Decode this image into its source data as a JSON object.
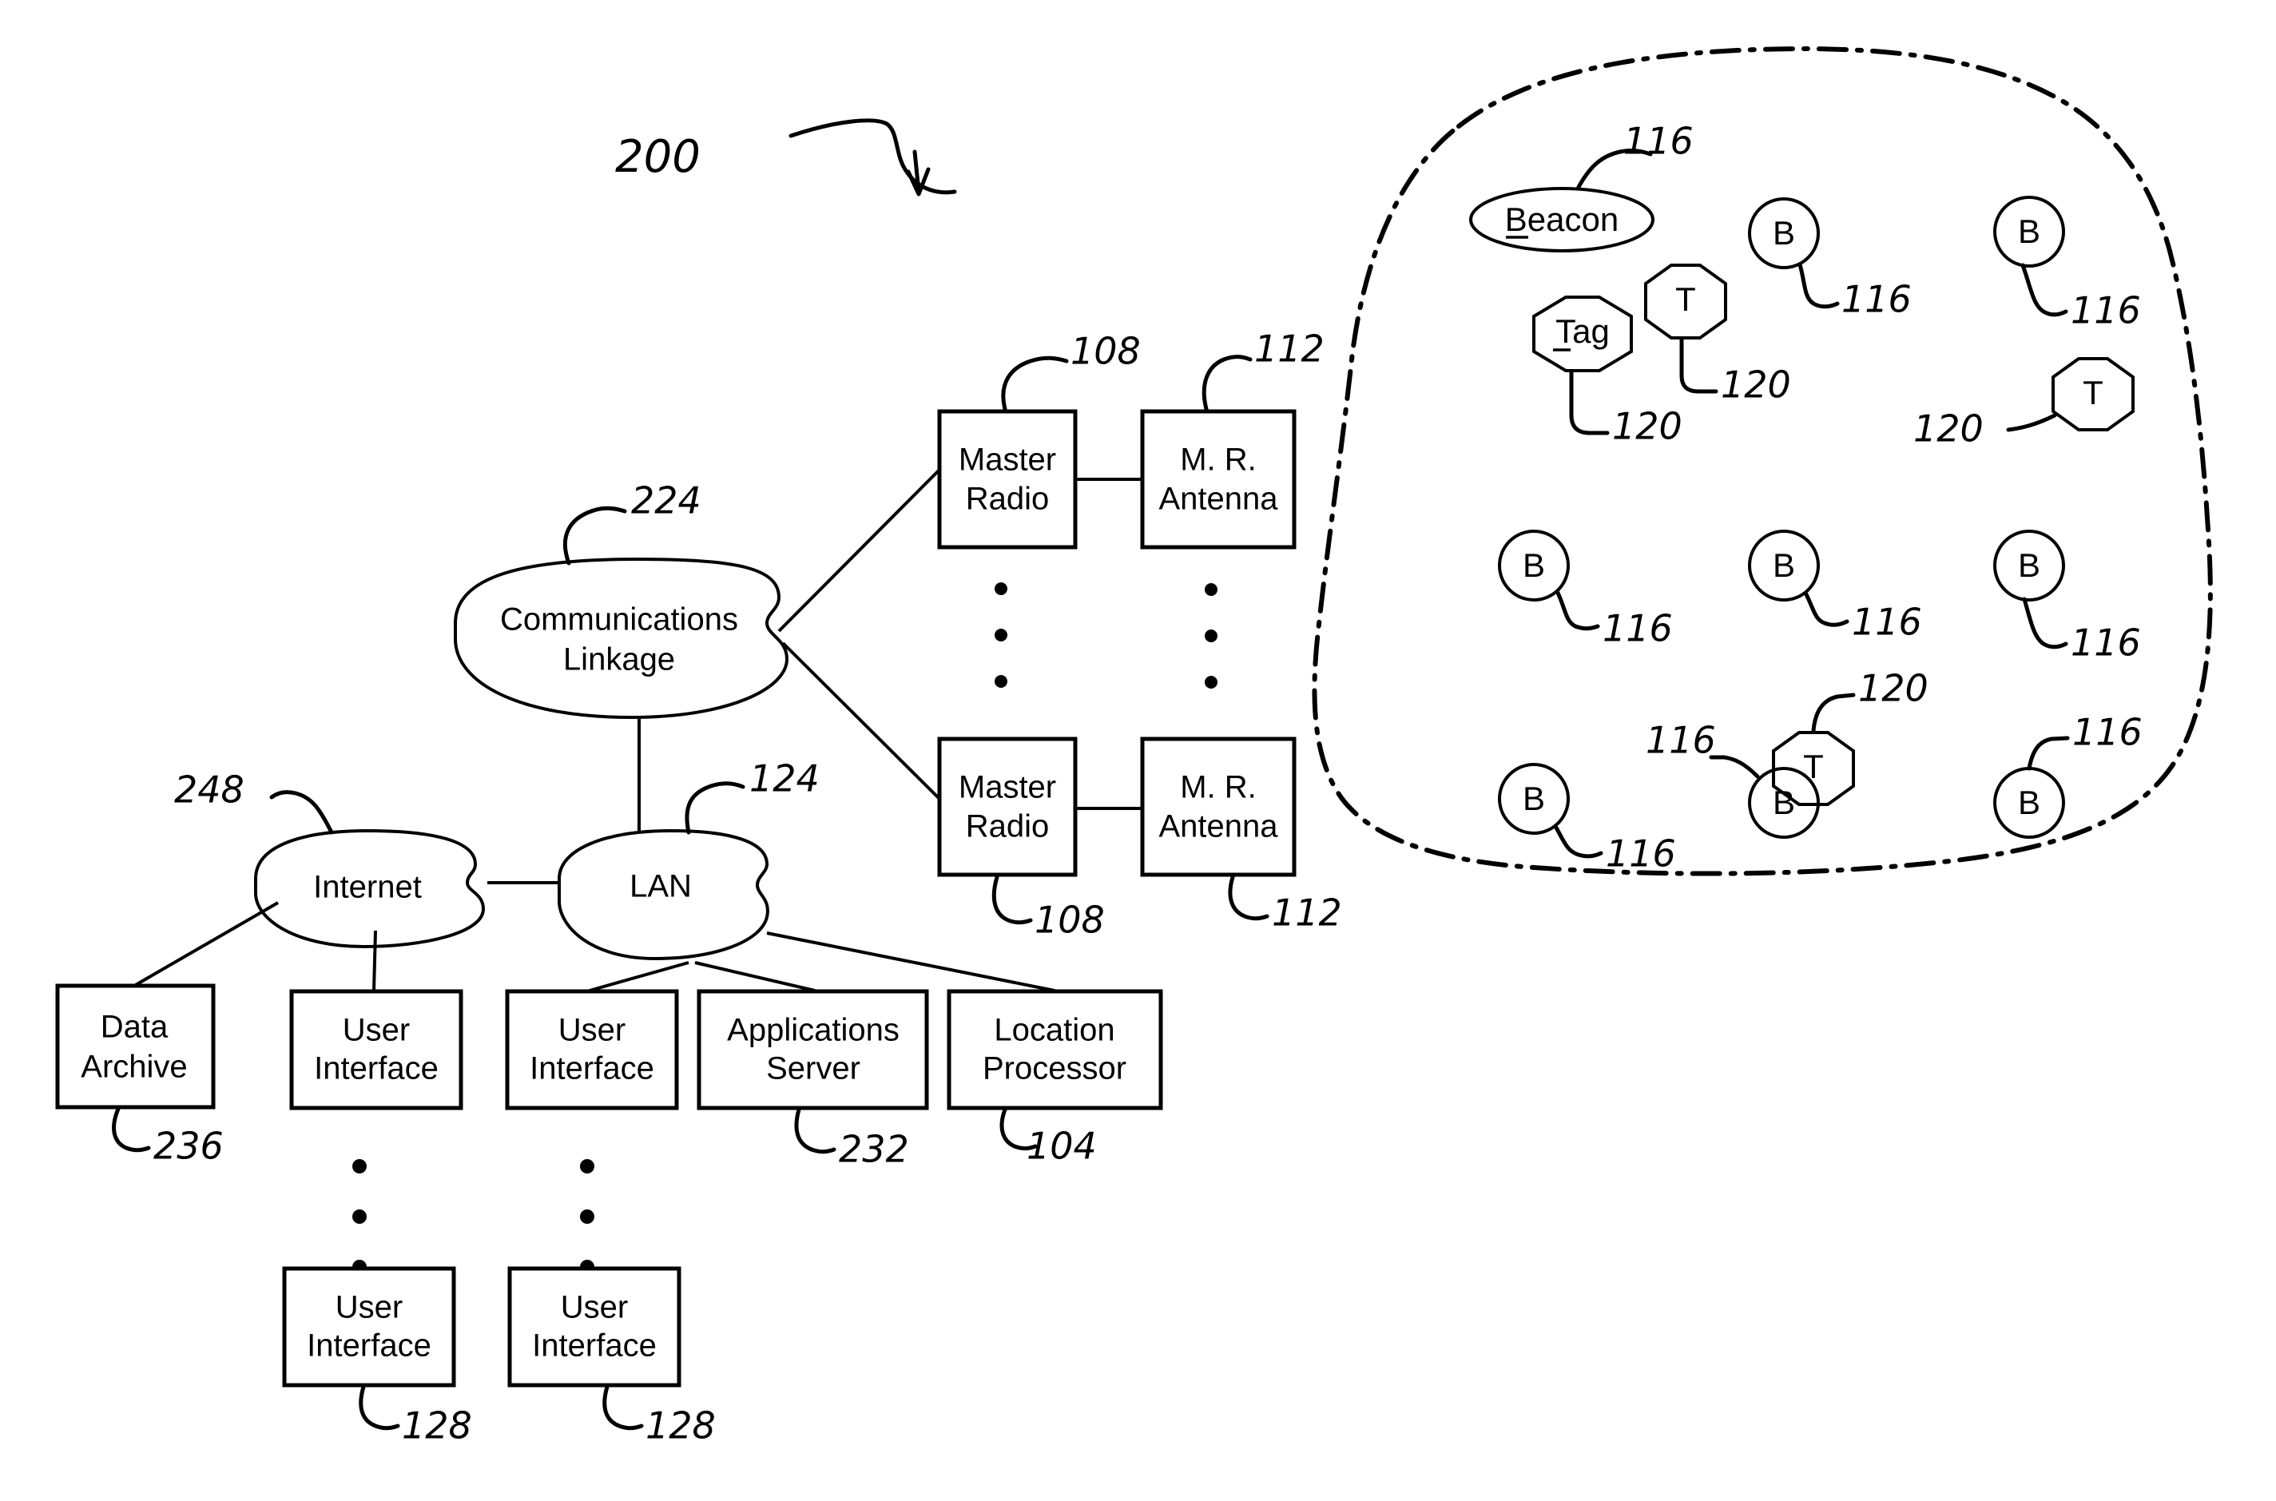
{
  "figure": {
    "id_label": "200",
    "type": "patent-system-block-diagram"
  },
  "boxes": [
    {
      "key": "master_radio_1",
      "label_line1": "Master",
      "label_line2": "Radio",
      "ref": "108"
    },
    {
      "key": "mr_antenna_1",
      "label_line1": "M. R.",
      "label_line2": "Antenna",
      "ref": "112"
    },
    {
      "key": "master_radio_2",
      "label_line1": "Master",
      "label_line2": "Radio",
      "ref": "108"
    },
    {
      "key": "mr_antenna_2",
      "label_line1": "M. R.",
      "label_line2": "Antenna",
      "ref": "112"
    },
    {
      "key": "data_archive",
      "label_line1": "Data",
      "label_line2": "Archive",
      "ref": "236"
    },
    {
      "key": "user_interface_1",
      "label_line1": "User",
      "label_line2": "Interface",
      "ref": ""
    },
    {
      "key": "user_interface_2",
      "label_line1": "User",
      "label_line2": "Interface",
      "ref": ""
    },
    {
      "key": "applications_server",
      "label_line1": "Applications",
      "label_line2": "Server",
      "ref": "232"
    },
    {
      "key": "location_processor",
      "label_line1": "Location",
      "label_line2": "Processor",
      "ref": "104"
    },
    {
      "key": "user_interface_3",
      "label_line1": "User",
      "label_line2": "Interface",
      "ref": "128"
    },
    {
      "key": "user_interface_4",
      "label_line1": "User",
      "label_line2": "Interface",
      "ref": "128"
    }
  ],
  "ovals": [
    {
      "key": "communications_linkage",
      "label_line1": "Communications",
      "label_line2": "Linkage",
      "ref": "224"
    },
    {
      "key": "internet",
      "label_line1": "Internet",
      "label_line2": "",
      "ref": "248"
    },
    {
      "key": "lan",
      "label_line1": "LAN",
      "label_line2": "",
      "ref": "124"
    }
  ],
  "legend": {
    "beacon_label": "Beacon",
    "beacon_ref": "116",
    "tag_label": "Tag",
    "tag_ref": "120"
  },
  "nodes": [
    {
      "key": "beacon-legend",
      "shape": "ellipse",
      "label": "Beacon",
      "ref": "116"
    },
    {
      "key": "tag-legend",
      "shape": "octagon",
      "label": "Tag",
      "ref": "120"
    },
    {
      "key": "tag-t1",
      "shape": "octagon",
      "label": "T",
      "ref": "120"
    },
    {
      "key": "beacon-b1",
      "shape": "circle",
      "label": "B",
      "ref": "116"
    },
    {
      "key": "beacon-b2",
      "shape": "circle",
      "label": "B",
      "ref": "116"
    },
    {
      "key": "tag-t2",
      "shape": "octagon",
      "label": "T",
      "ref": "120"
    },
    {
      "key": "beacon-b3",
      "shape": "circle",
      "label": "B",
      "ref": "116"
    },
    {
      "key": "beacon-b4",
      "shape": "circle",
      "label": "B",
      "ref": "116"
    },
    {
      "key": "beacon-b5",
      "shape": "circle",
      "label": "B",
      "ref": "116"
    },
    {
      "key": "tag-t3",
      "shape": "octagon",
      "label": "T",
      "ref": "120"
    },
    {
      "key": "beacon-b6",
      "shape": "circle",
      "label": "B",
      "ref": "116"
    },
    {
      "key": "beacon-b7",
      "shape": "circle",
      "label": "B",
      "ref": "116"
    },
    {
      "key": "beacon-b8",
      "shape": "circle",
      "label": "B",
      "ref": "116"
    }
  ],
  "ref_numbers": {
    "figure": "200",
    "master_radio": "108",
    "mr_antenna": "112",
    "communications_linkage": "224",
    "internet": "248",
    "lan": "124",
    "data_archive": "236",
    "applications_server": "232",
    "location_processor": "104",
    "user_interface": "128",
    "beacon": "116",
    "tag": "120"
  },
  "node_letters": {
    "beacon": "B",
    "tag": "T"
  },
  "colors": {
    "ink": "#000000",
    "paper": "#ffffff"
  }
}
